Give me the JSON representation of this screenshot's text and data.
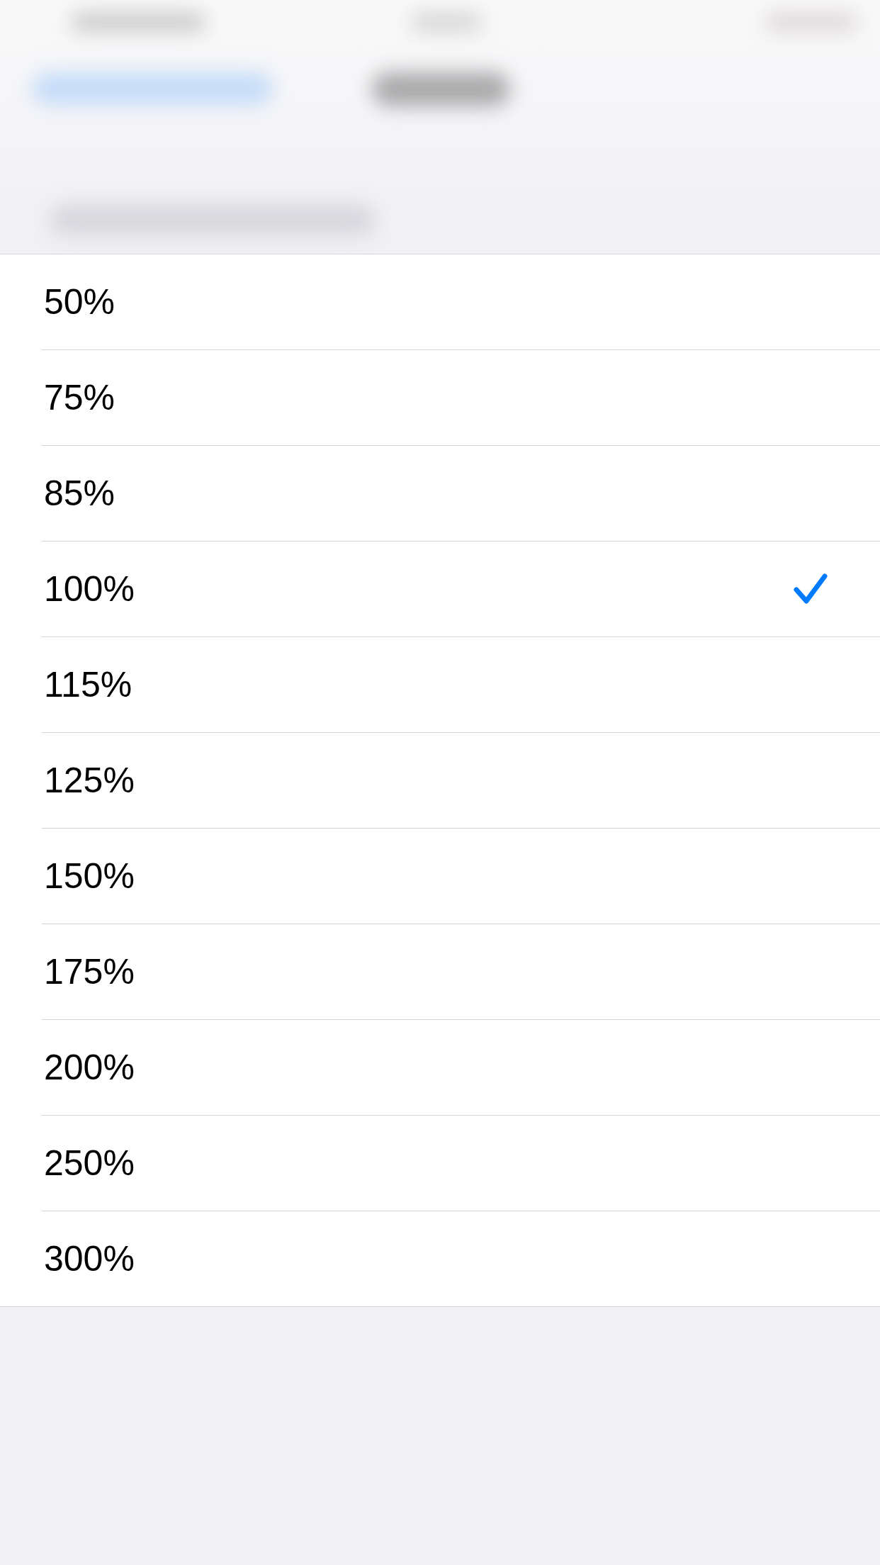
{
  "options": [
    {
      "label": "50%",
      "selected": false
    },
    {
      "label": "75%",
      "selected": false
    },
    {
      "label": "85%",
      "selected": false
    },
    {
      "label": "100%",
      "selected": true
    },
    {
      "label": "115%",
      "selected": false
    },
    {
      "label": "125%",
      "selected": false
    },
    {
      "label": "150%",
      "selected": false
    },
    {
      "label": "175%",
      "selected": false
    },
    {
      "label": "200%",
      "selected": false
    },
    {
      "label": "250%",
      "selected": false
    },
    {
      "label": "300%",
      "selected": false
    }
  ]
}
